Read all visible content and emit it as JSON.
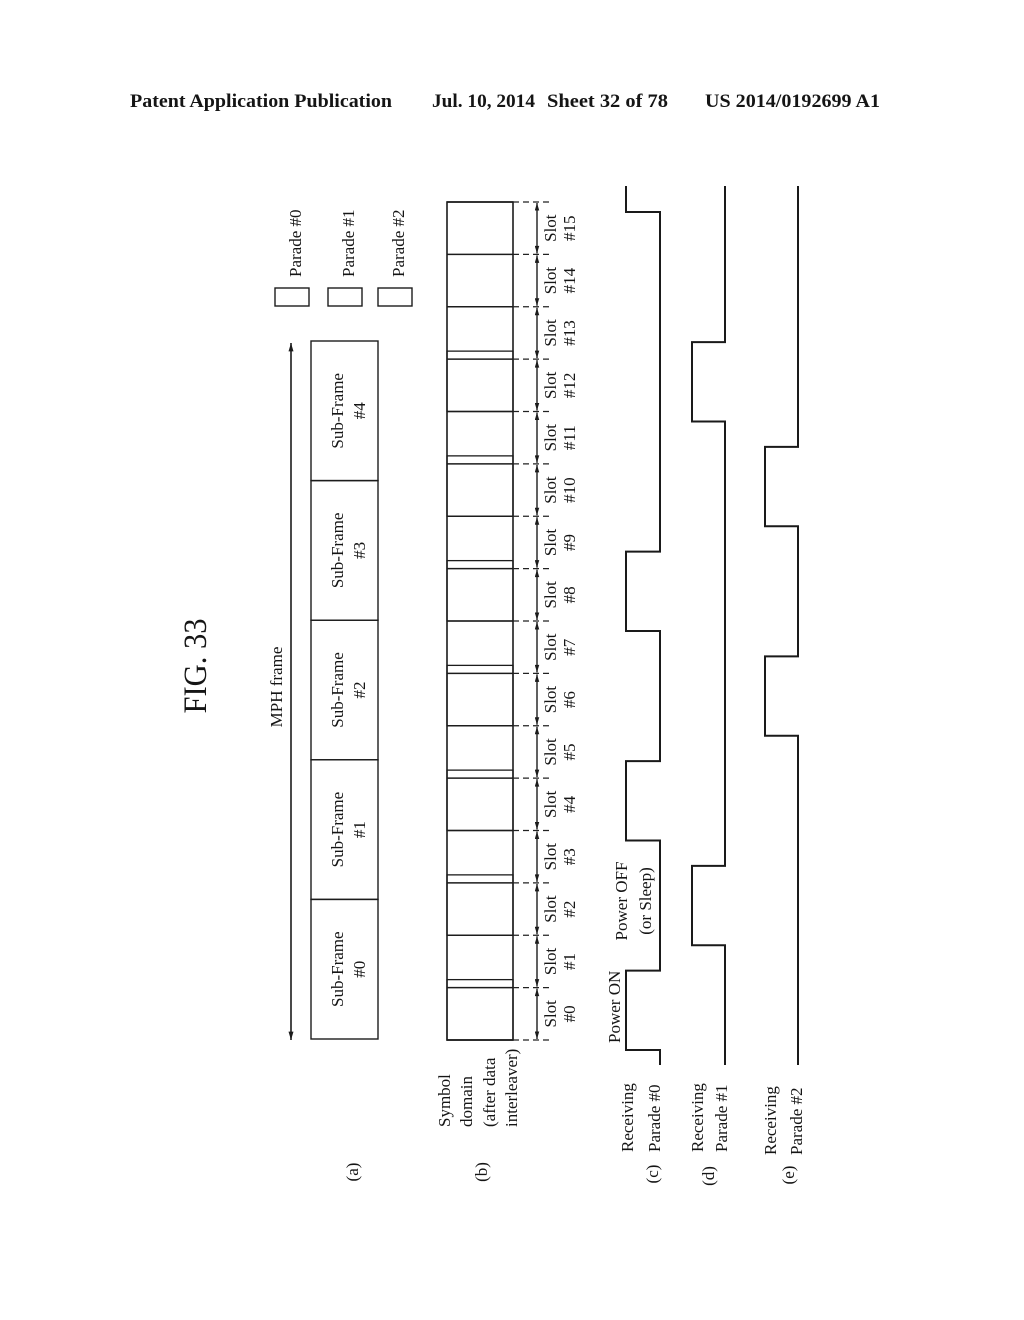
{
  "header": {
    "publication_type": "Patent Application Publication",
    "date": "Jul. 10, 2014",
    "sheet": "Sheet 32 of 78",
    "patent_number": "US 2014/0192699 A1"
  },
  "figure": {
    "title": "FIG. 33",
    "legend": [
      {
        "label": "Parade #0",
        "pattern": "hatch-backslash"
      },
      {
        "label": "Parade #1",
        "pattern": "hatch-slash"
      },
      {
        "label": "Parade #2",
        "pattern": "dots"
      }
    ],
    "panel_a": {
      "tag": "(a)",
      "mph_frame_label": "MPH frame",
      "sub_frames": [
        {
          "line1": "Sub-Frame",
          "line2": "#0"
        },
        {
          "line1": "Sub-Frame",
          "line2": "#1"
        },
        {
          "line1": "Sub-Frame",
          "line2": "#2"
        },
        {
          "line1": "Sub-Frame",
          "line2": "#3"
        },
        {
          "line1": "Sub-Frame",
          "line2": "#4"
        }
      ]
    },
    "panel_b": {
      "tag": "(b)",
      "label_lines": [
        "Symbol",
        "domain",
        "(after data",
        "interleaver)"
      ],
      "slots": [
        {
          "line1": "Slot",
          "line2": "#0"
        },
        {
          "line1": "Slot",
          "line2": "#1"
        },
        {
          "line1": "Slot",
          "line2": "#2"
        },
        {
          "line1": "Slot",
          "line2": "#3"
        },
        {
          "line1": "Slot",
          "line2": "#4"
        },
        {
          "line1": "Slot",
          "line2": "#5"
        },
        {
          "line1": "Slot",
          "line2": "#6"
        },
        {
          "line1": "Slot",
          "line2": "#7"
        },
        {
          "line1": "Slot",
          "line2": "#8"
        },
        {
          "line1": "Slot",
          "line2": "#9"
        },
        {
          "line1": "Slot",
          "line2": "#10"
        },
        {
          "line1": "Slot",
          "line2": "#11"
        },
        {
          "line1": "Slot",
          "line2": "#12"
        },
        {
          "line1": "Slot",
          "line2": "#13"
        },
        {
          "line1": "Slot",
          "line2": "#14"
        },
        {
          "line1": "Slot",
          "line2": "#15"
        }
      ],
      "slot_parade": [
        0,
        null,
        1,
        null,
        0,
        null,
        2,
        null,
        0,
        null,
        2,
        null,
        1,
        null,
        null,
        null
      ]
    },
    "panel_c": {
      "tag": "(c)",
      "label_lines": [
        "Receiving",
        "Parade #0"
      ],
      "parade": 0,
      "on_slots": [
        0,
        4,
        8
      ],
      "continues_into_next_frame": true,
      "state_labels": {
        "on": "Power ON",
        "off_line1": "Power OFF",
        "off_line2": "(or Sleep)"
      }
    },
    "panel_d": {
      "tag": "(d)",
      "label_lines": [
        "Receiving",
        "Parade #1"
      ],
      "parade": 1,
      "on_slots": [
        2,
        12
      ],
      "continues_into_next_frame": false
    },
    "panel_e": {
      "tag": "(e)",
      "label_lines": [
        "Receiving",
        "Parade #2"
      ],
      "parade": 2,
      "on_slots": [
        6,
        10
      ],
      "continues_into_next_frame": false
    }
  }
}
